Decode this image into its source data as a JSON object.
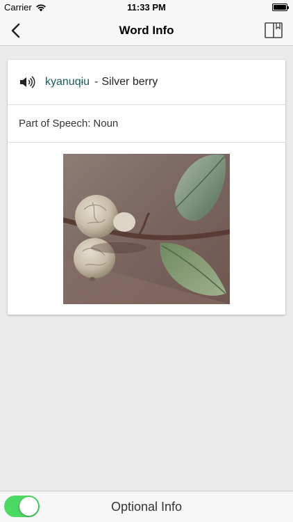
{
  "status_bar": {
    "carrier": "Carrier",
    "time": "11:33 PM"
  },
  "nav": {
    "title": "Word Info",
    "back_icon": "chevron-left-icon",
    "book_icon": "book-icon"
  },
  "word": {
    "native": "kyanuqɨu",
    "separator": "-",
    "english": "Silver berry"
  },
  "part_of_speech": {
    "label": "Part of Speech:",
    "value": "Noun"
  },
  "bottom_bar": {
    "toggle_on": true,
    "label": "Optional Info"
  },
  "colors": {
    "accent_word": "#1a5a5c",
    "toggle_on": "#4cd964",
    "background": "#ebebeb"
  }
}
